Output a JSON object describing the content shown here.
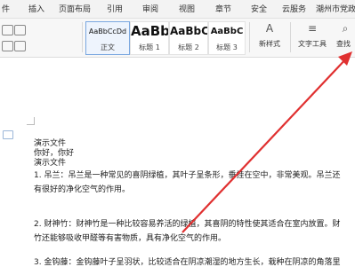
{
  "ribbon_tabs": [
    "件",
    "插入",
    "页面布局",
    "引用",
    "审阅",
    "视图",
    "章节",
    "安全",
    "云服务",
    "潮州市党政"
  ],
  "style_gallery": [
    {
      "preview": "AaBbCcDd",
      "name": "正文",
      "selected": true
    },
    {
      "preview": "AaBb",
      "name": "标题 1",
      "selected": false
    },
    {
      "preview": "AaBbC",
      "name": "标题 2",
      "selected": false
    },
    {
      "preview": "AaBbC",
      "name": "标题 3",
      "selected": false
    }
  ],
  "tools": {
    "new_style": "新样式",
    "text_tools": "文字工具",
    "find_replace": "查找"
  },
  "document": {
    "lines": [
      "演示文件",
      "你好，你好",
      "演示文件",
      "1. 吊兰：吊兰是一种常见的喜阴绿植，其叶子呈条形，垂挂在空中，非常美观。吊兰还",
      "有很好的净化空气的作用。",
      "",
      "2. 财神竹：财神竹是一种比较容易养活的绿植，其喜阴的特性使其适合在室内放置。财",
      "竹还能够吸收甲醛等有害物质，具有净化空气的作用。",
      "",
      "3. 金钩藤：金钩藤叶子呈羽状，比较适合在阴凉潮湿的地方生长，栽种在阴凉的角落里"
    ]
  },
  "annotation": {
    "arrow_color": "#e03030"
  }
}
